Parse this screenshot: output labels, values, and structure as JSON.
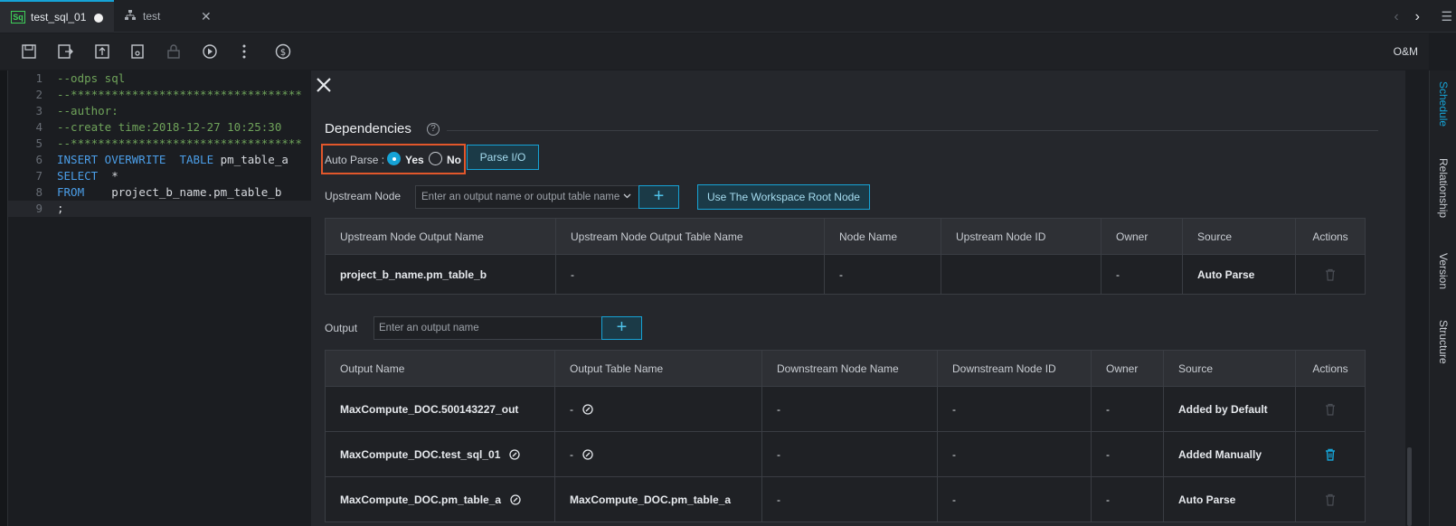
{
  "tabs": [
    {
      "icon": "Sq",
      "label": "test_sql_01"
    },
    {
      "label": "test"
    }
  ],
  "toolbar": {
    "om_label": "O&M"
  },
  "editor": {
    "lines": [
      {
        "n": "1",
        "text": "--odps sql"
      },
      {
        "n": "2",
        "text": "--**********************************"
      },
      {
        "n": "3",
        "text": "--author:"
      },
      {
        "n": "4",
        "text": "--create time:2018-12-27 10:25:30"
      },
      {
        "n": "5",
        "text": "--**********************************"
      },
      {
        "n": "6",
        "kw1": "INSERT OVERWRITE  TABLE",
        "rest": " pm_table_a"
      },
      {
        "n": "7",
        "kw1": "SELECT",
        "rest": "  *"
      },
      {
        "n": "8",
        "kw1": "FROM",
        "rest": "    project_b_name.pm_table_b"
      },
      {
        "n": "9",
        "text": ";"
      }
    ]
  },
  "dependencies": {
    "title": "Dependencies",
    "help": "?",
    "auto_parse_label": "Auto Parse :",
    "yes_label": "Yes",
    "no_label": "No",
    "parse_io_label": "Parse I/O",
    "upstream_label": "Upstream Node",
    "upstream_placeholder": "Enter an output name or output table name",
    "plus": "+",
    "root_node_label": "Use The Workspace Root Node",
    "upstream_headers": [
      "Upstream Node Output Name",
      "Upstream Node Output Table Name",
      "Node Name",
      "Upstream Node ID",
      "Owner",
      "Source",
      "Actions"
    ],
    "upstream_rows": [
      [
        "project_b_name.pm_table_b",
        "-",
        "-",
        "",
        "-",
        "Auto Parse"
      ]
    ],
    "output_label": "Output",
    "output_placeholder": "Enter an output name",
    "output_headers": [
      "Output Name",
      "Output Table Name",
      "Downstream Node Name",
      "Downstream Node ID",
      "Owner",
      "Source",
      "Actions"
    ],
    "output_rows": [
      [
        "MaxCompute_DOC.500143227_out",
        "-",
        "-",
        "-",
        "-",
        "Added by Default"
      ],
      [
        "MaxCompute_DOC.test_sql_01",
        "-",
        "-",
        "-",
        "-",
        "Added Manually"
      ],
      [
        "MaxCompute_DOC.pm_table_a",
        "MaxCompute_DOC.pm_table_a",
        "-",
        "-",
        "-",
        "Auto Parse"
      ]
    ]
  },
  "sidebar": [
    "Schedule",
    "Relationship",
    "Version",
    "Structure"
  ],
  "colors": {
    "accent": "#16a3d6",
    "highlight_box": "#e2572b"
  }
}
